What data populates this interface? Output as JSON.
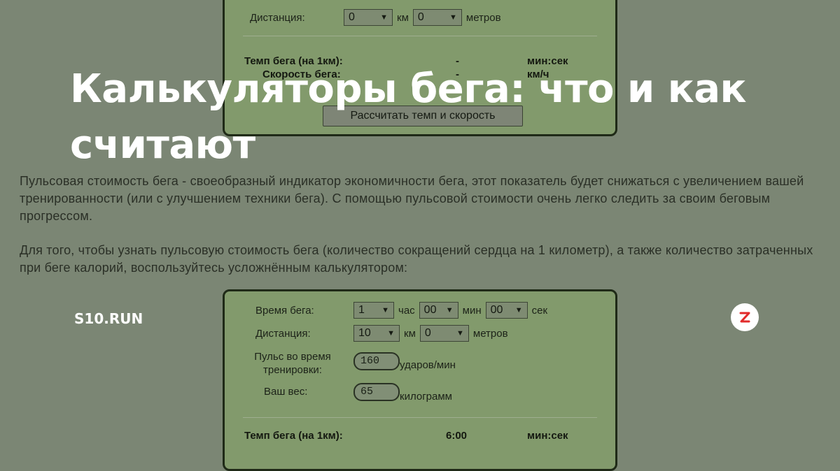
{
  "top_calculator": {
    "distance_label": "Дистанция:",
    "distance_km": "0",
    "km_unit": "км",
    "distance_m": "0",
    "m_unit": "метров",
    "pace_label": "Темп бега (на 1км):",
    "pace_value": "-",
    "pace_unit": "мин:сек",
    "speed_label": "Скорость бега:",
    "speed_value": "-",
    "speed_unit": "км/ч",
    "calc_button": "Рассчитать темп и скорость"
  },
  "article": {
    "title": "Калькуляторы бега: что и как считают",
    "paragraph1": "Пульсовая стоимость бега - своеобразный индикатор экономичности бега, этот показатель будет снижаться с увеличением вашей тренированности (или с улучшением техники бега). С помощью пульсовой стоимости очень легко следить за своим беговым прогрессом.",
    "paragraph2": "Для того, чтобы узнать пульсовую стоимость бега (количество сокращений сердца на 1 километр), а также количество затраченных при беге калорий, воспользуйтесь усложнённым калькулятором:"
  },
  "bottom_calculator": {
    "time_label": "Время бега:",
    "hours": "1",
    "hours_unit": "час",
    "minutes": "00",
    "minutes_unit": "мин",
    "seconds": "00",
    "seconds_unit": "сек",
    "distance_label": "Дистанция:",
    "distance_km": "10",
    "km_unit": "км",
    "distance_m": "0",
    "m_unit": "метров",
    "pulse_label_line1": "Пульс во время",
    "pulse_label_line2": "тренировки:",
    "pulse_value": "160",
    "pulse_unit": "ударов/мин",
    "weight_label": "Ваш вес:",
    "weight_value": "65",
    "weight_unit": "килограмм",
    "pace_label": "Темп бега (на 1км):",
    "pace_value": "6:00",
    "pace_unit": "мин:сек"
  },
  "overlay": {
    "site_name": "S10.RUN",
    "zen_icon": "zen-logo-icon",
    "zen_color": "#e22b2b"
  }
}
